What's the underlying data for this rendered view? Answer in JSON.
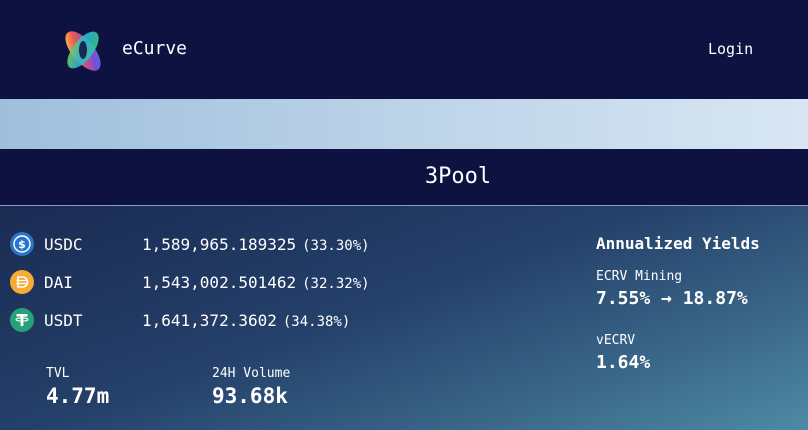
{
  "header": {
    "brand": "eCurve",
    "login_label": "Login"
  },
  "pool": {
    "title": "3Pool"
  },
  "coins": [
    {
      "symbol": "USDC",
      "amount": "1,589,965.189325",
      "share": "(33.30%)",
      "icon": "usdc-icon",
      "color": "#2775ca"
    },
    {
      "symbol": "DAI",
      "amount": "1,543,002.501462",
      "share": "(32.32%)",
      "icon": "dai-icon",
      "color": "#f5ac37"
    },
    {
      "symbol": "USDT",
      "amount": "1,641,372.3602",
      "share": "(34.38%)",
      "icon": "usdt-icon",
      "color": "#26a17b"
    }
  ],
  "stats": {
    "tvl_label": "TVL",
    "tvl_value": "4.77m",
    "volume_label": "24H Volume",
    "volume_value": "93.68k"
  },
  "yields": {
    "title": "Annualized Yields",
    "ecrv_label": "ECRV Mining",
    "ecrv_from": "7.55%",
    "ecrv_arrow": "→",
    "ecrv_to": "18.87%",
    "vecrv_label": "vECRV",
    "vecrv_value": "1.64%"
  },
  "colors": {
    "header_bg": "#0d1240",
    "band_start": "#9fbfdc",
    "band_end": "#d8e6f3"
  }
}
